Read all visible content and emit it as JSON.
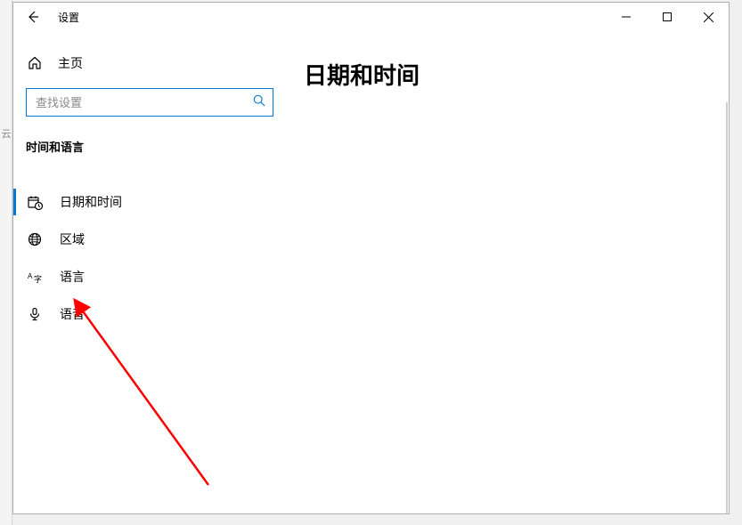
{
  "window": {
    "title": "设置"
  },
  "sidebar": {
    "home_label": "主页",
    "search_placeholder": "查找设置",
    "section_header": "时间和语言",
    "items": [
      {
        "label": "日期和时间"
      },
      {
        "label": "区域"
      },
      {
        "label": "语言"
      },
      {
        "label": "语音"
      }
    ]
  },
  "main": {
    "page_title": "日期和时间"
  }
}
